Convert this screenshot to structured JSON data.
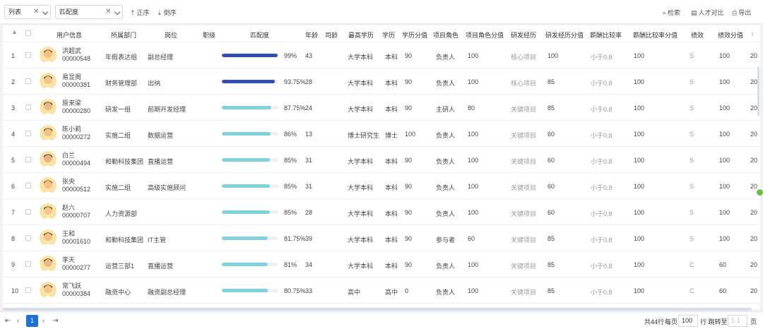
{
  "toolbar": {
    "view_select": "列表",
    "sort_select": "匹配度",
    "asc_label": "正序",
    "desc_label": "倒序",
    "search_label": "检索",
    "compare_label": "人才对比",
    "export_label": "导出"
  },
  "columns": {
    "user": "用户信息",
    "dept": "所属部门",
    "post": "岗位",
    "rank": "职级",
    "match": "匹配度",
    "age": "年龄",
    "tenure": "司龄",
    "edu": "最高学历",
    "degree": "学历",
    "degree_score": "学历分值",
    "role": "项目角色",
    "role_score": "项目角色分值",
    "rd": "研发经历",
    "rd_score": "研发经历分值",
    "salary": "薪酬比较率",
    "salary_score": "薪酬比较率分值",
    "perf": "绩效",
    "perf_score": "绩效分值",
    "more": "i"
  },
  "rows": [
    {
      "idx": "1",
      "name": "洪超武",
      "code": "00000548",
      "dept": "年假表达组",
      "post": "副总经理",
      "match_text": "99%",
      "match": 99,
      "age": "43",
      "edu": "大学本科",
      "degree": "本科",
      "degree_score": "90",
      "role": "负责人",
      "role_score": "100",
      "rd": "核心项目",
      "rd_score": "100",
      "salary": "小于0.8",
      "salary_score": "100",
      "perf": "S",
      "perf_score": "100",
      "extra": "20"
    },
    {
      "idx": "2",
      "name": "易显阁",
      "code": "00000381",
      "dept": "财务管理部",
      "post": "出纳",
      "match_text": "93.75%",
      "match": 93.75,
      "age": "28",
      "edu": "大学本科",
      "degree": "本科",
      "degree_score": "90",
      "role": "负责人",
      "role_score": "100",
      "rd": "核心项目",
      "rd_score": "85",
      "salary": "小于0.8",
      "salary_score": "100",
      "perf": "S",
      "perf_score": "100",
      "extra": "20"
    },
    {
      "idx": "3",
      "name": "原来梁",
      "code": "00000280",
      "dept": "研发一组",
      "post": "前期开发经理",
      "match_text": "87.75%",
      "match": 87.75,
      "age": "24",
      "edu": "大学本科",
      "degree": "本科",
      "degree_score": "90",
      "role": "主研人",
      "role_score": "80",
      "rd": "关键项目",
      "rd_score": "85",
      "salary": "小于0.8",
      "salary_score": "100",
      "perf": "S",
      "perf_score": "100",
      "extra": "20"
    },
    {
      "idx": "4",
      "name": "陈小莉",
      "code": "00000272",
      "dept": "实施二组",
      "post": "数据运营",
      "match_text": "86%",
      "match": 86,
      "age": "13",
      "edu": "博士研究生",
      "degree": "博士",
      "degree_score": "100",
      "role": "负责人",
      "role_score": "100",
      "rd": "关键项目",
      "rd_score": "60",
      "salary": "小于0.8",
      "salary_score": "100",
      "perf": "S",
      "perf_score": "100",
      "extra": "20"
    },
    {
      "idx": "5",
      "name": "白兰",
      "code": "00000494",
      "dept": "和勤科技集团",
      "post": "直播运营",
      "match_text": "85%",
      "match": 85,
      "age": "31",
      "edu": "大学本科",
      "degree": "本科",
      "degree_score": "90",
      "role": "负责人",
      "role_score": "100",
      "rd": "关键项目",
      "rd_score": "60",
      "salary": "小于0.8",
      "salary_score": "100",
      "perf": "S",
      "perf_score": "100",
      "extra": "20"
    },
    {
      "idx": "6",
      "name": "张央",
      "code": "00000512",
      "dept": "实施二组",
      "post": "高级实施顾问",
      "match_text": "85%",
      "match": 85,
      "age": "31",
      "edu": "大学本科",
      "degree": "本科",
      "degree_score": "90",
      "role": "负责人",
      "role_score": "100",
      "rd": "关键项目",
      "rd_score": "60",
      "salary": "小于0.8",
      "salary_score": "100",
      "perf": "S",
      "perf_score": "100",
      "extra": "20"
    },
    {
      "idx": "7",
      "name": "赵六",
      "code": "00000707",
      "dept": "人力资源部",
      "post": "",
      "match_text": "85%",
      "match": 85,
      "age": "28",
      "edu": "大学本科",
      "degree": "本科",
      "degree_score": "90",
      "role": "负责人",
      "role_score": "100",
      "rd": "关键项目",
      "rd_score": "60",
      "salary": "小于0.8",
      "salary_score": "100",
      "perf": "S",
      "perf_score": "100",
      "extra": "20"
    },
    {
      "idx": "8",
      "name": "王和",
      "code": "00001610",
      "dept": "和勤科技集团",
      "post": "IT主管",
      "match_text": "81.75%",
      "match": 81.75,
      "age": "39",
      "edu": "大学本科",
      "degree": "本科",
      "degree_score": "90",
      "role": "参与者",
      "role_score": "60",
      "rd": "关键项目",
      "rd_score": "85",
      "salary": "小于0.8",
      "salary_score": "100",
      "perf": "S",
      "perf_score": "100",
      "extra": "20"
    },
    {
      "idx": "9",
      "name": "李天",
      "code": "00000277",
      "dept": "运营三部1",
      "post": "直播运营",
      "match_text": "81%",
      "match": 81,
      "age": "34",
      "edu": "大学本科",
      "degree": "本科",
      "degree_score": "90",
      "role": "负责人",
      "role_score": "100",
      "rd": "关键项目",
      "rd_score": "85",
      "salary": "小于0.8",
      "salary_score": "100",
      "perf": "C",
      "perf_score": "60",
      "extra": "20"
    },
    {
      "idx": "10",
      "name": "常飞跃",
      "code": "00000384",
      "dept": "融资中心",
      "post": "融资副总经理",
      "match_text": "80.75%",
      "match": 80.75,
      "age": "33",
      "edu": "高中",
      "degree": "高中",
      "degree_score": "0",
      "role": "负责人",
      "role_score": "100",
      "rd": "关键项目",
      "rd_score": "85",
      "salary": "小于0.8",
      "salary_score": "100",
      "perf": "C",
      "perf_score": "60",
      "extra": "20"
    }
  ],
  "pager": {
    "current": "1",
    "total_text": "共44行",
    "per_page_label": "每页",
    "per_page": "100",
    "goto_label": "行 跳转至",
    "goto_value": "1-1",
    "page_suffix": "页"
  },
  "colors": {
    "accent": "#1e6fd9",
    "bar_dark": "#2f4fb5",
    "bar_light": "#7fd3dc"
  }
}
